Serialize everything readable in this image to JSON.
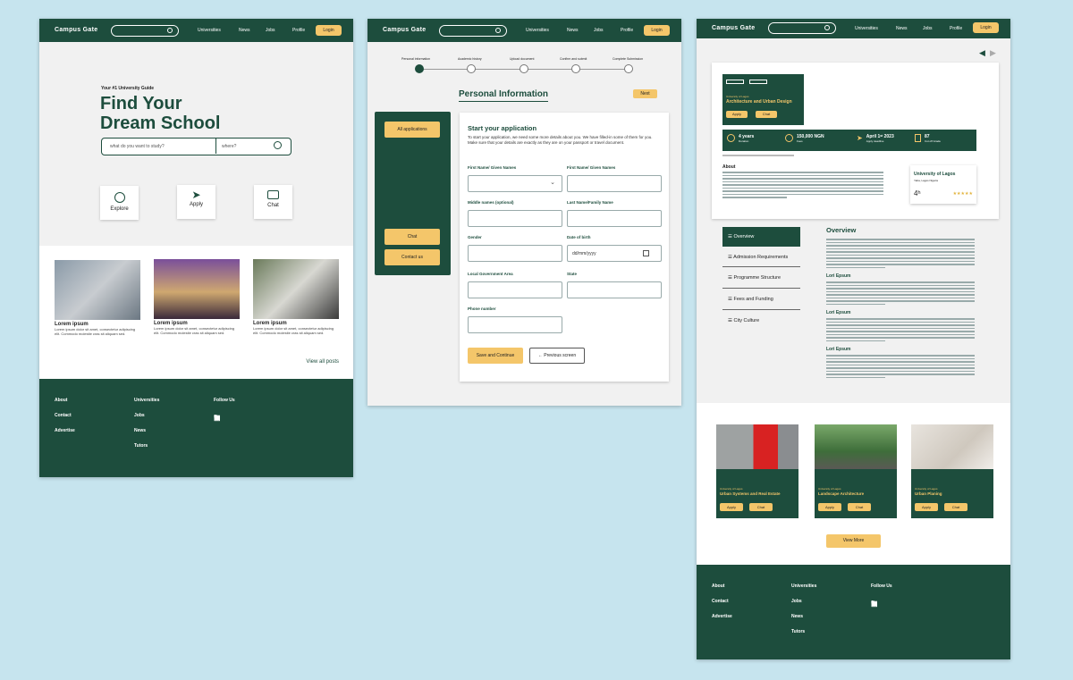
{
  "brand": "Campus Gate",
  "nav": {
    "universities": "Universities",
    "news": "News",
    "jobs": "Jobs",
    "profile": "Profile",
    "login": "Login"
  },
  "p1": {
    "tagline": "Your #1 University Guide",
    "hero1": "Find Your",
    "hero2": "Dream School",
    "search_placeholder": "what do you want to study?",
    "where_placeholder": "where?",
    "explore": "Explore",
    "apply": "Apply",
    "chat": "Chat",
    "posts": [
      {
        "title": "Lorem ipsum",
        "body": "Lorem ipsum dolor sit amet, consectetur adipiscing elit. Commodo molestie cras sit aliquam sed."
      },
      {
        "title": "Lorem ipsum",
        "body": "Lorem ipsum dolor sit amet, consectetur adipiscing elit. Commodo molestie cras sit aliquam sed."
      },
      {
        "title": "Lorem ipsum",
        "body": "Lorem ipsum dolor sit amet, consectetur adipiscing elit. Commodo molestie cras sit aliquam sed."
      }
    ],
    "view_all": "View all posts"
  },
  "footer": {
    "about": "About",
    "contact": "Contact",
    "advertise": "Advertise",
    "universities": "Universities",
    "jobs": "Jobs",
    "news": "News",
    "tutors": "Tutors",
    "follow": "Follow Us"
  },
  "p2": {
    "steps": [
      "Personal information",
      "Academic history",
      "Upload document",
      "Confirm and submit",
      "Complete Submission"
    ],
    "heading": "Personal Information",
    "next": "Next",
    "all_apps": "All applications",
    "chat": "Chat",
    "contact": "Contact us",
    "form_title": "Start your application",
    "form_intro1": "To start your application, we need some more details about you. We have filled-in some of them for you.",
    "form_intro2": "Make sure that your details are exactly as they are on your passport or travel document.",
    "first_name1": "First Name/ Given Names",
    "first_name2": "First Name/ Given Names",
    "middle": "Middle names (optional)",
    "last": "Last Name/Family Name",
    "gender": "Gender",
    "dob": "Date of birth",
    "dob_placeholder": "dd/mm/yyyy",
    "lga": "Local Government Area",
    "state": "State",
    "phone": "Phone number",
    "save": "Save and Continue",
    "prev": "Previous screen"
  },
  "p3": {
    "hero_univ": "University of Lagos",
    "hero_course": "Architecture and Urban Design",
    "apply": "Apply",
    "chat": "Chat",
    "stats": [
      {
        "v": "4 years",
        "l": "Duration"
      },
      {
        "v": "150,000 NGN",
        "l": "Fees"
      },
      {
        "v": "April 1ˢᵗ 2023",
        "l": "Apply deadline"
      },
      {
        "v": "87",
        "l": "Cut off Grade"
      }
    ],
    "about": "About",
    "univ_card_name": "University of Lagos",
    "univ_card_loc": "Yaba, Lagos Nigeria",
    "univ_rank": "4ʰ",
    "tabs": [
      "Overview",
      "Admission Requirements",
      "Programme Structure",
      "Fees and Funding",
      "City Culture"
    ],
    "overview": "Overview",
    "subs": [
      "Lori Epsum",
      "Lori Epsum",
      "Lori Epsum"
    ],
    "courses": [
      {
        "univ": "University of Lagos",
        "name": "Urban Systems and Real Estate"
      },
      {
        "univ": "University of Lagos",
        "name": "Landscape Architecture"
      },
      {
        "univ": "University of Lagos",
        "name": "Urban Planing"
      }
    ],
    "view_more": "View More"
  },
  "colors": {
    "brand_green": "#1d4d3d",
    "accent_yellow": "#f4c66a",
    "background": "#c6e4ee"
  }
}
